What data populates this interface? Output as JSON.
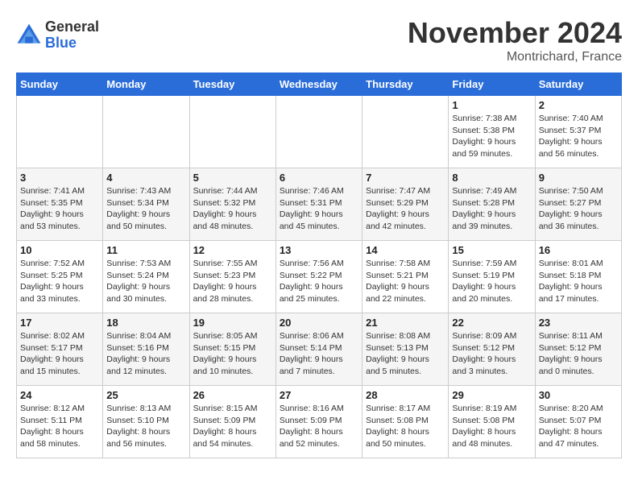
{
  "logo": {
    "general": "General",
    "blue": "Blue"
  },
  "header": {
    "month": "November 2024",
    "location": "Montrichard, France"
  },
  "weekdays": [
    "Sunday",
    "Monday",
    "Tuesday",
    "Wednesday",
    "Thursday",
    "Friday",
    "Saturday"
  ],
  "weeks": [
    [
      {
        "day": "",
        "info": ""
      },
      {
        "day": "",
        "info": ""
      },
      {
        "day": "",
        "info": ""
      },
      {
        "day": "",
        "info": ""
      },
      {
        "day": "",
        "info": ""
      },
      {
        "day": "1",
        "info": "Sunrise: 7:38 AM\nSunset: 5:38 PM\nDaylight: 9 hours and 59 minutes."
      },
      {
        "day": "2",
        "info": "Sunrise: 7:40 AM\nSunset: 5:37 PM\nDaylight: 9 hours and 56 minutes."
      }
    ],
    [
      {
        "day": "3",
        "info": "Sunrise: 7:41 AM\nSunset: 5:35 PM\nDaylight: 9 hours and 53 minutes."
      },
      {
        "day": "4",
        "info": "Sunrise: 7:43 AM\nSunset: 5:34 PM\nDaylight: 9 hours and 50 minutes."
      },
      {
        "day": "5",
        "info": "Sunrise: 7:44 AM\nSunset: 5:32 PM\nDaylight: 9 hours and 48 minutes."
      },
      {
        "day": "6",
        "info": "Sunrise: 7:46 AM\nSunset: 5:31 PM\nDaylight: 9 hours and 45 minutes."
      },
      {
        "day": "7",
        "info": "Sunrise: 7:47 AM\nSunset: 5:29 PM\nDaylight: 9 hours and 42 minutes."
      },
      {
        "day": "8",
        "info": "Sunrise: 7:49 AM\nSunset: 5:28 PM\nDaylight: 9 hours and 39 minutes."
      },
      {
        "day": "9",
        "info": "Sunrise: 7:50 AM\nSunset: 5:27 PM\nDaylight: 9 hours and 36 minutes."
      }
    ],
    [
      {
        "day": "10",
        "info": "Sunrise: 7:52 AM\nSunset: 5:25 PM\nDaylight: 9 hours and 33 minutes."
      },
      {
        "day": "11",
        "info": "Sunrise: 7:53 AM\nSunset: 5:24 PM\nDaylight: 9 hours and 30 minutes."
      },
      {
        "day": "12",
        "info": "Sunrise: 7:55 AM\nSunset: 5:23 PM\nDaylight: 9 hours and 28 minutes."
      },
      {
        "day": "13",
        "info": "Sunrise: 7:56 AM\nSunset: 5:22 PM\nDaylight: 9 hours and 25 minutes."
      },
      {
        "day": "14",
        "info": "Sunrise: 7:58 AM\nSunset: 5:21 PM\nDaylight: 9 hours and 22 minutes."
      },
      {
        "day": "15",
        "info": "Sunrise: 7:59 AM\nSunset: 5:19 PM\nDaylight: 9 hours and 20 minutes."
      },
      {
        "day": "16",
        "info": "Sunrise: 8:01 AM\nSunset: 5:18 PM\nDaylight: 9 hours and 17 minutes."
      }
    ],
    [
      {
        "day": "17",
        "info": "Sunrise: 8:02 AM\nSunset: 5:17 PM\nDaylight: 9 hours and 15 minutes."
      },
      {
        "day": "18",
        "info": "Sunrise: 8:04 AM\nSunset: 5:16 PM\nDaylight: 9 hours and 12 minutes."
      },
      {
        "day": "19",
        "info": "Sunrise: 8:05 AM\nSunset: 5:15 PM\nDaylight: 9 hours and 10 minutes."
      },
      {
        "day": "20",
        "info": "Sunrise: 8:06 AM\nSunset: 5:14 PM\nDaylight: 9 hours and 7 minutes."
      },
      {
        "day": "21",
        "info": "Sunrise: 8:08 AM\nSunset: 5:13 PM\nDaylight: 9 hours and 5 minutes."
      },
      {
        "day": "22",
        "info": "Sunrise: 8:09 AM\nSunset: 5:12 PM\nDaylight: 9 hours and 3 minutes."
      },
      {
        "day": "23",
        "info": "Sunrise: 8:11 AM\nSunset: 5:12 PM\nDaylight: 9 hours and 0 minutes."
      }
    ],
    [
      {
        "day": "24",
        "info": "Sunrise: 8:12 AM\nSunset: 5:11 PM\nDaylight: 8 hours and 58 minutes."
      },
      {
        "day": "25",
        "info": "Sunrise: 8:13 AM\nSunset: 5:10 PM\nDaylight: 8 hours and 56 minutes."
      },
      {
        "day": "26",
        "info": "Sunrise: 8:15 AM\nSunset: 5:09 PM\nDaylight: 8 hours and 54 minutes."
      },
      {
        "day": "27",
        "info": "Sunrise: 8:16 AM\nSunset: 5:09 PM\nDaylight: 8 hours and 52 minutes."
      },
      {
        "day": "28",
        "info": "Sunrise: 8:17 AM\nSunset: 5:08 PM\nDaylight: 8 hours and 50 minutes."
      },
      {
        "day": "29",
        "info": "Sunrise: 8:19 AM\nSunset: 5:08 PM\nDaylight: 8 hours and 48 minutes."
      },
      {
        "day": "30",
        "info": "Sunrise: 8:20 AM\nSunset: 5:07 PM\nDaylight: 8 hours and 47 minutes."
      }
    ]
  ]
}
